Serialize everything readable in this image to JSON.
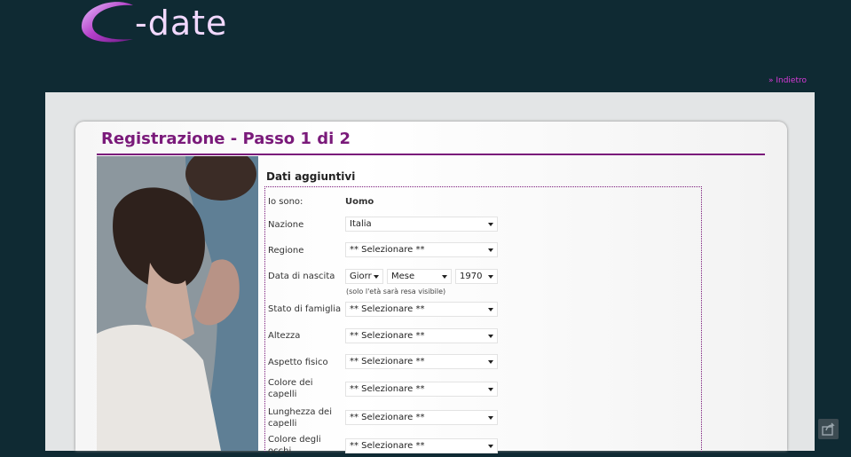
{
  "brand": {
    "logo_text": "-date"
  },
  "nav": {
    "back_label": "» Indietro"
  },
  "page": {
    "title": "Registrazione - Passo 1 di 2",
    "section_title": "Dati aggiuntivi"
  },
  "form": {
    "gender": {
      "label": "Io sono:",
      "value": "Uomo"
    },
    "nation": {
      "label": "Nazione",
      "value": "Italia"
    },
    "region": {
      "label": "Regione",
      "value": "** Selezionare **"
    },
    "birthdate": {
      "label": "Data di nascita",
      "day": "Giorr",
      "month": "Mese",
      "year": "1970",
      "hint": "(solo l'età sarà resa visibile)"
    },
    "marital": {
      "label": "Stato di famiglia",
      "value": "** Selezionare **"
    },
    "height": {
      "label": "Altezza",
      "value": "** Selezionare **"
    },
    "body": {
      "label": "Aspetto fisico",
      "value": "** Selezionare **"
    },
    "hair_color": {
      "label_line1": "Colore dei",
      "label_line2": "capelli",
      "value": "** Selezionare **"
    },
    "hair_length": {
      "label_line1": "Lunghezza dei",
      "label_line2": "capelli",
      "value": "** Selezionare **"
    },
    "eye_color": {
      "label_line1": "Colore degli",
      "label_line2": "occhi",
      "value": "** Selezionare **"
    }
  },
  "colors": {
    "background": "#0f2a33",
    "accent": "#7a1a7a",
    "link": "#d83ad8"
  }
}
